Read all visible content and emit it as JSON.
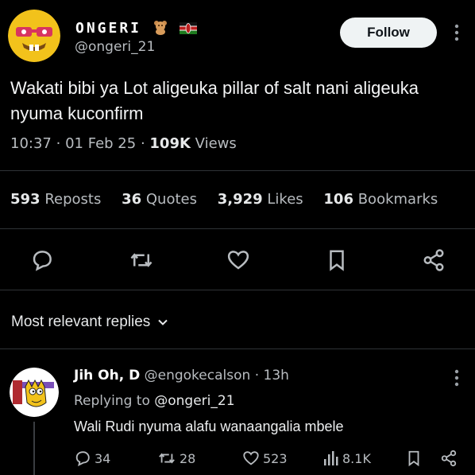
{
  "post": {
    "display_name": "ONGERI",
    "name_emojis": [
      "teddy-bear",
      "kenya-flag"
    ],
    "handle": "@ongeri_21",
    "follow_label": "Follow",
    "text": "Wakati bibi ya Lot aligeuka pillar of salt nani aligeuka nyuma kuconfirm",
    "time": "10:37",
    "date": "01 Feb 25",
    "views_count": "109K",
    "views_label": "Views",
    "separator": "·"
  },
  "stats": [
    {
      "count": "593",
      "label": "Reposts"
    },
    {
      "count": "36",
      "label": "Quotes"
    },
    {
      "count": "3,929",
      "label": "Likes"
    },
    {
      "count": "106",
      "label": "Bookmarks"
    }
  ],
  "actions": [
    "reply-icon",
    "repost-icon",
    "like-icon",
    "bookmark-icon",
    "share-icon"
  ],
  "replies_sort": {
    "label": "Most relevant replies"
  },
  "reply": {
    "name": "Jih Oh, D",
    "handle": "@engokecalson",
    "separator": "·",
    "age": "13h",
    "replying_prefix": "Replying to",
    "replying_to": "@ongeri_21",
    "text": "Wali Rudi nyuma alafu wanaangalia mbele",
    "replies": "34",
    "reposts": "28",
    "likes": "523",
    "views": "8.1K"
  },
  "colors": {
    "background": "#000000",
    "text": "#e7e9ea",
    "muted": "#b8bcc0",
    "divider": "#2f3336",
    "follow_bg": "#eff3f4"
  }
}
